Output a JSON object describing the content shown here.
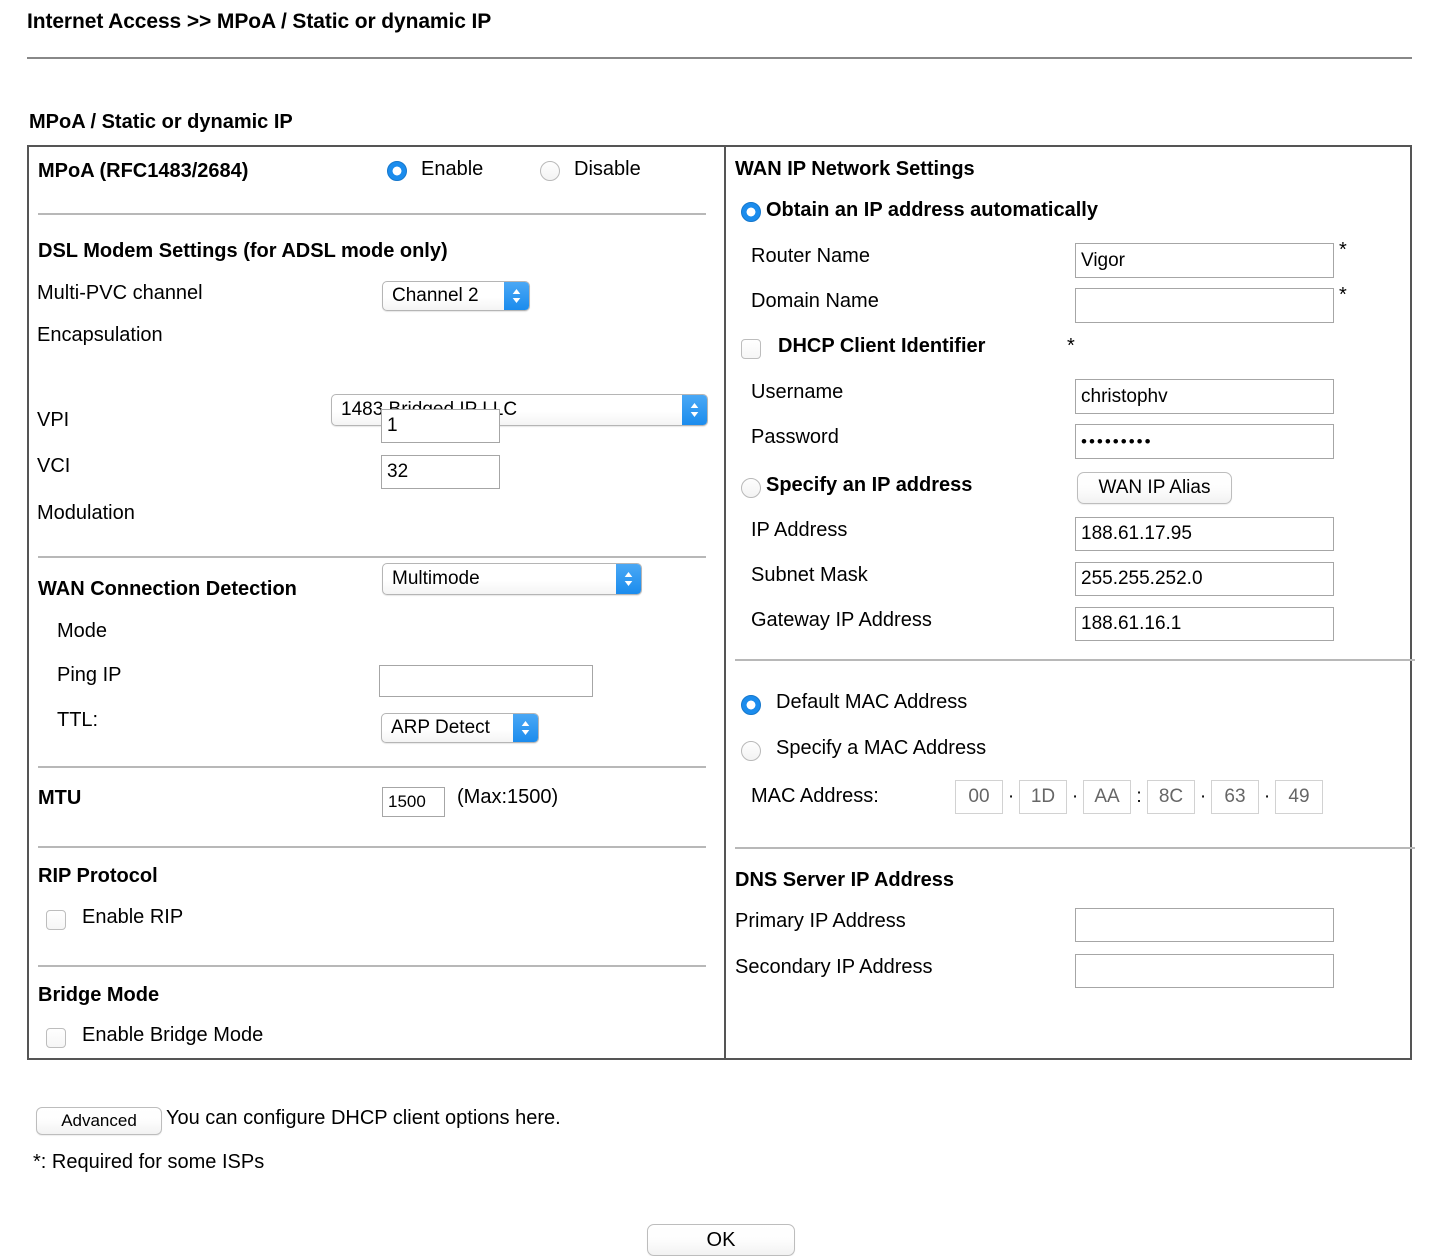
{
  "breadcrumb": "Internet Access >> MPoA / Static or dynamic IP",
  "page_title": "MPoA / Static or dynamic IP",
  "left": {
    "mpoa": {
      "label": "MPoA (RFC1483/2684)",
      "enable_label": "Enable",
      "disable_label": "Disable",
      "selected": "Enable"
    },
    "dsl": {
      "title": "DSL Modem Settings (for ADSL mode only)",
      "multi_pvc_label": "Multi-PVC channel",
      "multi_pvc_value": "Channel 2",
      "encapsulation_label": "Encapsulation",
      "encapsulation_value": "1483 Bridged IP LLC",
      "vpi_label": "VPI",
      "vpi_value": "1",
      "vci_label": "VCI",
      "vci_value": "32",
      "modulation_label": "Modulation",
      "modulation_value": "Multimode"
    },
    "wan_detect": {
      "title": "WAN Connection Detection",
      "mode_label": "Mode",
      "mode_value": "ARP Detect",
      "ping_ip_label": "Ping IP",
      "ping_ip_value": "",
      "ttl_label": "TTL:"
    },
    "mtu": {
      "label": "MTU",
      "value": "1500",
      "max_note": "(Max:1500)"
    },
    "rip": {
      "title": "RIP Protocol",
      "enable_label": "Enable RIP",
      "checked": false
    },
    "bridge": {
      "title": "Bridge Mode",
      "enable_label": "Enable Bridge Mode",
      "checked": false
    }
  },
  "right": {
    "wan_ip": {
      "title": "WAN IP Network Settings",
      "obtain_auto_label": "Obtain an IP address automatically",
      "router_name_label": "Router Name",
      "router_name_value": "Vigor",
      "router_name_star": "*",
      "domain_name_label": "Domain Name",
      "domain_name_value": "",
      "domain_name_star": "*",
      "dhcp_client_id_label": "DHCP Client Identifier",
      "dhcp_client_id_star": "*",
      "dhcp_client_id_checked": false,
      "username_label": "Username",
      "username_value": "christophv",
      "password_label": "Password",
      "password_value": "•••••••••",
      "specify_ip_label": "Specify an IP address",
      "wan_ip_alias_button": "WAN IP Alias",
      "ip_address_label": "IP Address",
      "ip_address_value": "188.61.17.95",
      "subnet_mask_label": "Subnet Mask",
      "subnet_mask_value": "255.255.252.0",
      "gateway_label": "Gateway IP Address",
      "gateway_value": "188.61.16.1",
      "selected_mode": "Obtain an IP address automatically"
    },
    "mac": {
      "default_label": "Default MAC Address",
      "specify_label": "Specify a MAC Address",
      "selected": "Default MAC Address",
      "address_label": "MAC Address:",
      "octets": [
        "00",
        "1D",
        "AA",
        "8C",
        "63",
        "49"
      ],
      "separators": [
        "·",
        "·",
        ":",
        "·",
        "·"
      ]
    },
    "dns": {
      "title": "DNS Server IP Address",
      "primary_label": "Primary IP Address",
      "primary_value": "",
      "secondary_label": "Secondary IP Address",
      "secondary_value": ""
    }
  },
  "footer": {
    "advanced_button": "Advanced",
    "advanced_note": "You can configure DHCP client options here.",
    "required_note": "*: Required for some ISPs",
    "ok_button": "OK"
  },
  "colors": {
    "accent_blue": "#1b8ced",
    "panel_border": "#555555",
    "rule_gray": "#b8b8b8"
  }
}
